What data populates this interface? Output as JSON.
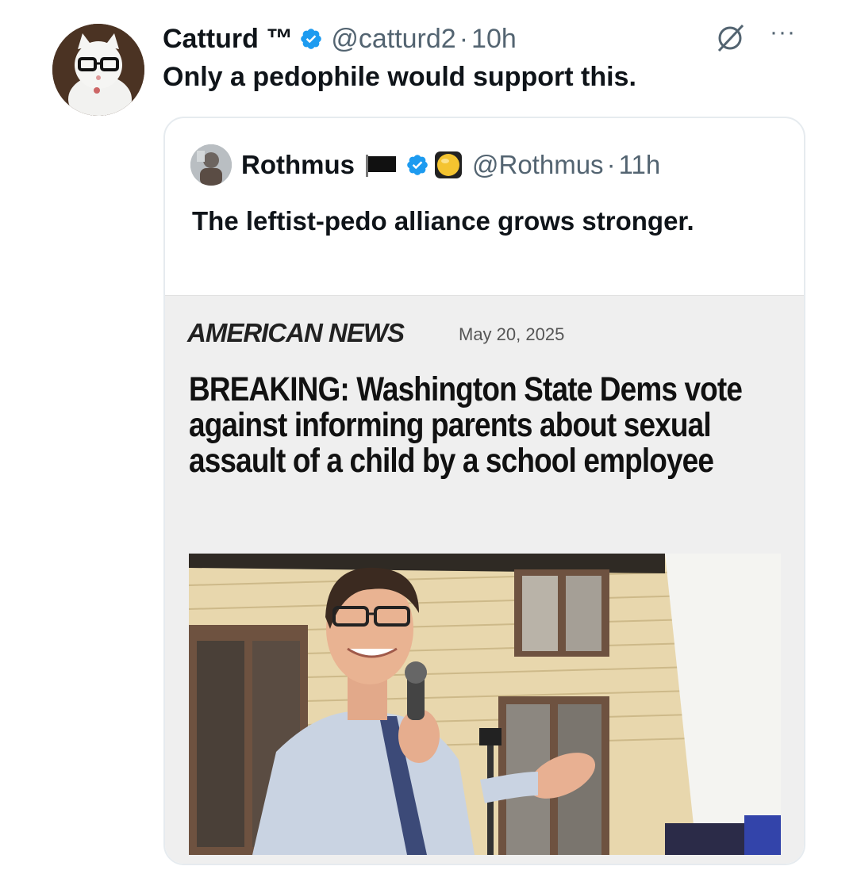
{
  "tweet": {
    "author_name": "Catturd ™",
    "handle": "@catturd2",
    "separator": "·",
    "time": "10h",
    "text": "Only a pedophile would support this.",
    "more_icon": "more-icon",
    "grok_icon": "grok-icon"
  },
  "quote": {
    "author_name": "Rothmus",
    "handle": "@Rothmus",
    "separator": "·",
    "time": "11h",
    "text": "The leftist-pedo alliance grows stronger.",
    "badges": [
      "black-flag-icon",
      "verified-icon",
      "yellow-orb-icon"
    ]
  },
  "article": {
    "source": "AMERICAN NEWS",
    "date": "May 20, 2025",
    "headline": "BREAKING: Washington State Dems vote against informing parents about sexual assault of a child by a school employee"
  },
  "colors": {
    "verified_blue": "#1d9bf0",
    "secondary_text": "#536471",
    "article_bg": "#efefef"
  }
}
